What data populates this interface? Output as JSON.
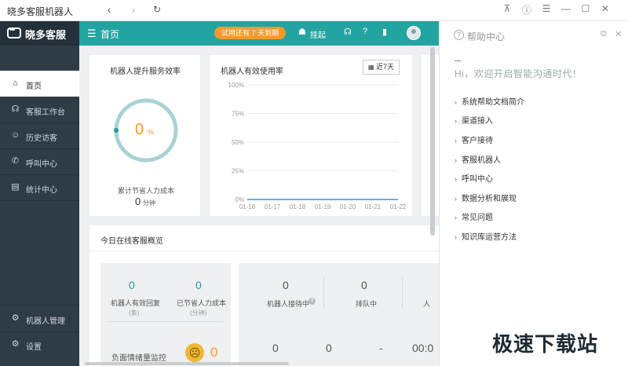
{
  "window": {
    "title": "晓多客服机器人",
    "controls": [
      "pin-icon",
      "info-icon",
      "menu-icon",
      "minimize-icon",
      "maximize-icon",
      "close-icon"
    ]
  },
  "brand": {
    "name": "晓多客服"
  },
  "sidebar": {
    "items": [
      {
        "label": "首页",
        "icon": "home-icon",
        "active": true
      },
      {
        "label": "客服工作台",
        "icon": "agent-icon"
      },
      {
        "label": "历史访客",
        "icon": "visitors-icon"
      },
      {
        "label": "呼叫中心",
        "icon": "phone-icon"
      },
      {
        "label": "统计中心",
        "icon": "chart-icon"
      }
    ],
    "bottom_items": [
      {
        "label": "机器人管理",
        "icon": "robot-icon"
      },
      {
        "label": "设置",
        "icon": "settings-icon"
      }
    ]
  },
  "header": {
    "breadcrumb": "首页",
    "trial_badge": "试用还有 7 天到期",
    "hang_label": "挂起"
  },
  "efficiency_card": {
    "title": "机器人提升服务效率",
    "value": "0",
    "unit": "%",
    "saved_label": "累计节省人力成本",
    "saved_value": "0",
    "saved_unit": "分钟"
  },
  "usage_card": {
    "title": "机器人有效使用率",
    "range_button": "近7天"
  },
  "chart_data": {
    "type": "line",
    "title": "机器人有效使用率",
    "x": [
      "01-16",
      "01-17",
      "01-18",
      "01-19",
      "01-20",
      "01-21",
      "01-22"
    ],
    "series": [
      {
        "values": [
          0,
          0,
          0,
          0,
          0,
          0,
          0
        ]
      }
    ],
    "y_ticks": [
      "100%",
      "75%",
      "50%",
      "25%",
      "0%"
    ],
    "ylim": [
      0,
      100
    ],
    "grid": true,
    "color": "#4a90c8"
  },
  "overview": {
    "title": "今日在线客服概览",
    "left_stats": [
      {
        "value": "0",
        "label": "机器人有效回复",
        "sub": "(条)"
      },
      {
        "value": "0",
        "label": "已节省人力成本",
        "sub": "(分钟)"
      }
    ],
    "right_stats": [
      {
        "value": "0",
        "label": "机器人接待中"
      },
      {
        "value": "0",
        "label": "排队中"
      },
      {
        "value": "人",
        "label": ""
      }
    ],
    "sentiment_label": "负面情绪量监控",
    "sentiment_value": "0",
    "bottom_values": [
      "0",
      "0",
      "-",
      "00:0"
    ]
  },
  "help": {
    "title": "帮助中心",
    "greeting": "Hi，欢迎开启智能沟通时代！",
    "items": [
      "系统帮助文档简介",
      "渠道接入",
      "客户接待",
      "客服机器人",
      "呼叫中心",
      "数据分析和展现",
      "常见问题",
      "知识库运营方法"
    ]
  },
  "watermark": "极速下载站",
  "colors": {
    "teal": "#24a4a0",
    "sidebar": "#2e3c45",
    "orange": "#f39a2b",
    "ring": "#a9d3d3"
  }
}
